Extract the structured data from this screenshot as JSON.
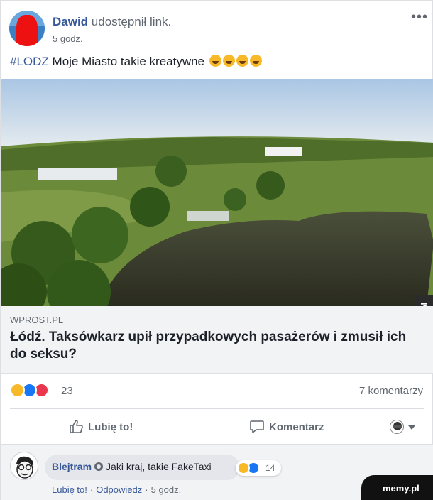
{
  "post": {
    "author_name": "Dawid",
    "author_action": "udostępnił link.",
    "timestamp": "5 godz.",
    "more_label": "•••",
    "hashtag": "#LODZ",
    "text": "Moje Miasto takie kreatywne",
    "emojis": [
      "rolling-on-floor-laughing",
      "grinning-squinting",
      "rolling-on-floor-laughing",
      "grinning-squinting"
    ]
  },
  "link": {
    "domain": "WPROST.PL",
    "title": "Łódź. Taksówkarz upił przypadkowych pasażerów i zmusił ich do seksu?"
  },
  "watermark": {
    "side": "memy.pl",
    "corner": "memy.pl"
  },
  "reactions": {
    "types": [
      "haha",
      "like",
      "love"
    ],
    "count": "23",
    "comments": "7 komentarzy"
  },
  "actions": {
    "like": "Lubię to!",
    "comment": "Komentarz"
  },
  "comment": {
    "author": "Blejtram",
    "text": "Jaki kraj, takie FakeTaxi",
    "reaction_count": "14",
    "like": "Lubię to!",
    "reply": "Odpowiedz",
    "time": "5 godz."
  },
  "colors": {
    "link_blue": "#365899",
    "meta_gray": "#606770",
    "like_blue": "#1877f2",
    "love_red": "#e8374e",
    "haha_yellow": "#f7b928"
  }
}
